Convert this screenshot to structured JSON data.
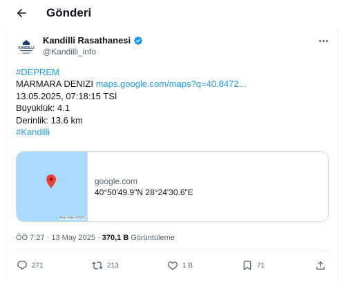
{
  "header": {
    "title": "Gönderi"
  },
  "author": {
    "name": "Kandilli Rasathanesi",
    "handle": "@Kandilli_info",
    "avatar_text": "KANDİLLİ"
  },
  "tweet": {
    "lines": [
      {
        "type": "hashtag",
        "text": "#DEPREM"
      },
      {
        "type": "mixed",
        "text": "MARMARA DENIZI ",
        "link": "maps.google.com/maps?q=40.8472..."
      },
      {
        "type": "text",
        "text": "13.05.2025, 07:18:15 TSİ"
      },
      {
        "type": "text",
        "text": "Büyüklük: 4.1"
      },
      {
        "type": "text",
        "text": "Derinlik: 13.6 km"
      },
      {
        "type": "hashtag",
        "text": "#Kandilli"
      }
    ]
  },
  "card": {
    "domain": "google.com",
    "coords": "40°50'49.9\"N 28°24'30.6\"E",
    "map_attribution": "Map data ©2025"
  },
  "meta": {
    "time": "ÖÖ 7:27",
    "sep1": " · ",
    "date": "13 May 2025",
    "sep2": " · ",
    "views": "370,1 B",
    "views_label": " Görüntüleme"
  },
  "actions": {
    "reply": "271",
    "retweet": "213",
    "like": "1 B",
    "bookmark": "71"
  },
  "colors": {
    "link": "#1d9bf0",
    "verified": "#1d9bf0",
    "map_water": "#aadaff",
    "pin": "#ea4335"
  }
}
